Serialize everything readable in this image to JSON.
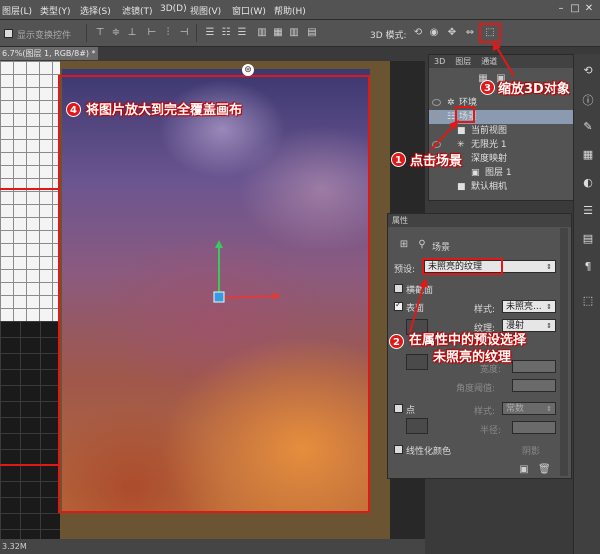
{
  "menubar": {
    "items": [
      {
        "label": "图层(L)"
      },
      {
        "label": "类型(Y)"
      },
      {
        "label": "选择(S)"
      },
      {
        "label": "滤镜(T)"
      },
      {
        "label": "3D(D)"
      },
      {
        "label": "视图(V)"
      },
      {
        "label": "窗口(W)"
      },
      {
        "label": "帮助(H)"
      }
    ]
  },
  "optionsbar": {
    "show_transform_label": "显示变换控件",
    "mode_label": "3D 模式:"
  },
  "document": {
    "tab_title": "6.7%(图层 1, RGB/8#) *"
  },
  "status": {
    "doc_size": "3.32M"
  },
  "panel3d": {
    "tabs": [
      "3D",
      "图层",
      "通道"
    ],
    "rows": [
      {
        "label": "环境"
      },
      {
        "label": "场景"
      },
      {
        "label": "当前视图"
      },
      {
        "label": "无限光 1"
      },
      {
        "label": "深度映射"
      },
      {
        "label": "图层 1"
      },
      {
        "label": "默认相机"
      }
    ]
  },
  "properties": {
    "header": "属性",
    "tab_label": "场景",
    "preset_label": "预设:",
    "preset_value": "未照亮的纹理",
    "crosssection_label": "横截面",
    "surface_label": "表面",
    "style_label": "样式:",
    "style_value": "未照亮...",
    "texture_label": "纹理:",
    "texture_value": "漫射",
    "crease_label": "角度阈值:",
    "width_label": "宽度:",
    "points_label": "点",
    "points_style_label": "样式:",
    "points_style_value": "常数",
    "radius_label": "半径:",
    "linearize_label": "线性化颜色",
    "shadow_label": "阴影"
  },
  "annotations": {
    "n1": "1",
    "t1": "点击场景",
    "n2": "2",
    "t2_line1": "在属性中的预设选择",
    "t2_line2": "未照亮的纹理",
    "n3": "3",
    "t3": "缩放3D对象",
    "n4": "4",
    "t4": "将图片放大到完全覆盖画布"
  },
  "colors": {
    "annotation_red": "#e01818",
    "selected_row": "#8a9ab0"
  }
}
